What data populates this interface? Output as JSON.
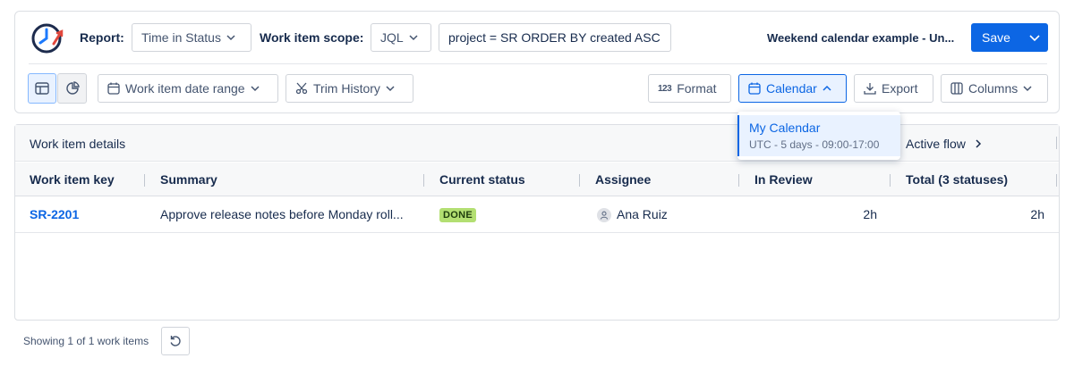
{
  "header": {
    "report_label": "Report:",
    "report_value": "Time in Status",
    "scope_label": "Work item scope:",
    "scope_type": "JQL",
    "jql_query": "project = SR ORDER BY created ASC",
    "title": "Weekend calendar example - Un...",
    "save_label": "Save"
  },
  "toolbar": {
    "date_range_label": "Work item date range",
    "trim_history_label": "Trim History",
    "format_label": "Format",
    "format_icon_text": "123",
    "calendar_label": "Calendar",
    "export_label": "Export",
    "columns_label": "Columns"
  },
  "calendar_menu": {
    "items": [
      {
        "label": "My Calendar",
        "detail": "UTC - 5 days - 09:00-17:00"
      }
    ]
  },
  "table": {
    "group_left": "Work item details",
    "group_right": "Active flow",
    "columns": [
      "Work item key",
      "Summary",
      "Current status",
      "Assignee",
      "In Review",
      "Total (3 statuses)"
    ],
    "rows": [
      {
        "key": "SR-2201",
        "summary": "Approve release notes before Monday roll...",
        "status": "DONE",
        "assignee": "Ana Ruiz",
        "in_review": "2h",
        "total": "2h"
      }
    ]
  },
  "footer": {
    "count_text": "Showing 1 of 1 work items"
  },
  "colors": {
    "accent": "#0c66e4",
    "status_done": "#b3df72",
    "link": "#0c66e4"
  },
  "icons": {
    "logo": "clock-report-icon",
    "table_view": "table-icon",
    "chart_view": "pie-chart-icon",
    "date_range": "calendar-icon",
    "trim": "scissors-icon",
    "calendar": "calendar-icon",
    "export": "download-icon",
    "columns": "columns-icon",
    "refresh": "refresh-icon",
    "assignee": "person-icon"
  }
}
